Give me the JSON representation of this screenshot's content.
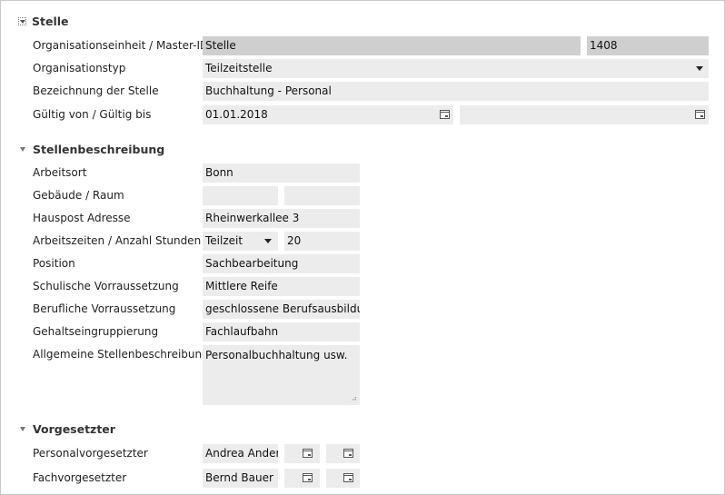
{
  "sections": {
    "stelle": {
      "title": "Stelle"
    },
    "beschreibung": {
      "title": "Stellenbeschreibung"
    },
    "vorgesetzter": {
      "title": "Vorgesetzter"
    }
  },
  "stelle": {
    "org_label": "Organisationseinheit / Master-ID",
    "org_value": "Stelle",
    "master_id": "1408",
    "typ_label": "Organisationstyp",
    "typ_value": "Teilzeitstelle",
    "bez_label": "Bezeichnung der Stelle",
    "bez_value": "Buchhaltung - Personal",
    "gueltig_label": "Gültig von / Gültig bis",
    "gueltig_von": "01.01.2018",
    "gueltig_bis": ""
  },
  "beschreibung": {
    "arbeitsort_label": "Arbeitsort",
    "arbeitsort": "Bonn",
    "gebaeude_label": "Gebäude / Raum",
    "gebaeude": "",
    "raum": "",
    "hauspost_label": "Hauspost Adresse",
    "hauspost": "Rheinwerkallee 3",
    "arbeitszeit_label": "Arbeitszeiten / Anzahl Stunden",
    "arbeitszeit": "Teilzeit",
    "stunden": "20",
    "position_label": "Position",
    "position": "Sachbearbeitung",
    "schulisch_label": "Schulische Vorraussetzung",
    "schulisch": "Mittlere Reife",
    "beruflich_label": "Berufliche Vorraussetzung",
    "beruflich": "geschlossene Berufsausbildung",
    "gehalt_label": "Gehaltseingruppierung",
    "gehalt": "Fachlaufbahn",
    "allgemein_label": "Allgemeine Stellenbeschreibung",
    "allgemein": "Personalbuchhaltung usw."
  },
  "vorgesetzter": {
    "personal_label": "Personalvorgesetzter",
    "personal": "Andrea Anders",
    "fach_label": "Fachvorgesetzter",
    "fach": "Bernd Bauer"
  },
  "icons": {
    "calendar": "calendar-icon",
    "dropdown": "chevron-down-icon",
    "collapse": "collapse-icon",
    "resize": "resize-grip-icon"
  }
}
